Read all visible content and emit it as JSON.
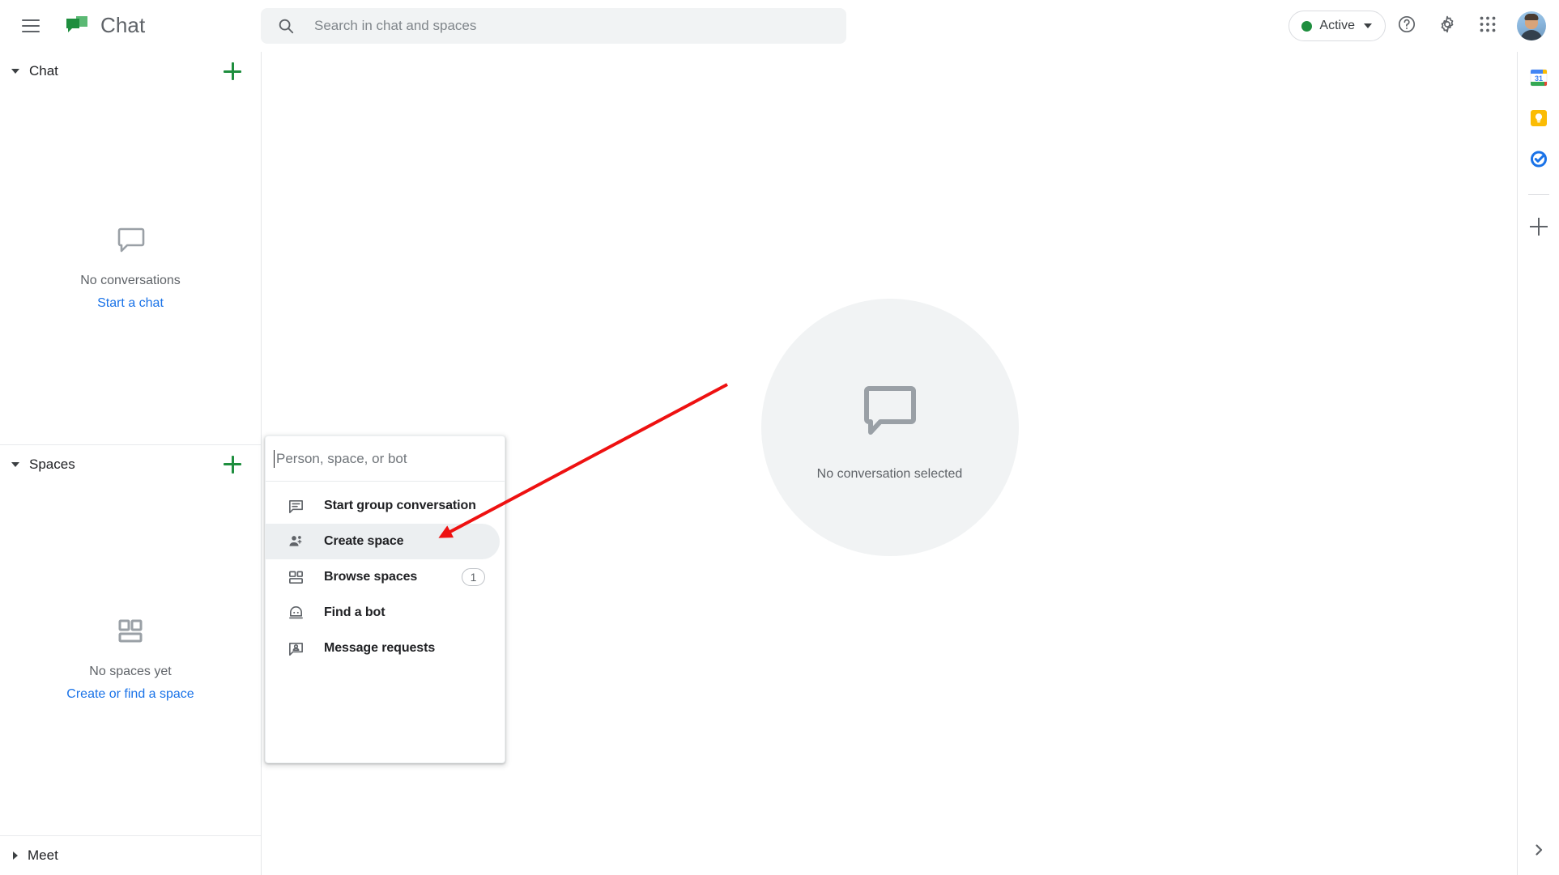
{
  "app": {
    "title": "Chat",
    "logo_icon": "google-chat-logo"
  },
  "topbar": {
    "menu_icon": "hamburger-menu-icon",
    "search": {
      "icon": "search-icon",
      "placeholder": "Search in chat and spaces",
      "value": ""
    },
    "status": {
      "label": "Active",
      "dot_color": "#1e8e3e",
      "caret_icon": "chevron-down-icon"
    },
    "help_icon": "help-question-circle-icon",
    "settings_icon": "gear-icon",
    "apps_icon": "apps-grid-icon",
    "avatar_icon": "user-avatar"
  },
  "sidebar": {
    "chat": {
      "title": "Chat",
      "expanded": true,
      "collapse_icon": "triangle-down-icon",
      "add_icon": "plus-icon",
      "empty_icon": "speech-bubble-icon",
      "empty_title": "No conversations",
      "empty_link": "Start a chat"
    },
    "spaces": {
      "title": "Spaces",
      "expanded": true,
      "collapse_icon": "triangle-down-icon",
      "add_icon": "plus-icon",
      "empty_icon": "spaces-grid-icon",
      "empty_title": "No spaces yet",
      "empty_link": "Create or find a space"
    },
    "meet": {
      "title": "Meet",
      "expanded": false,
      "collapse_icon": "triangle-right-icon"
    }
  },
  "main": {
    "empty_icon": "speech-bubble-icon",
    "empty_text": "No conversation selected"
  },
  "rail": {
    "items": [
      {
        "name": "google-calendar-icon",
        "label": "Calendar",
        "day": "31"
      },
      {
        "name": "google-keep-icon",
        "label": "Keep"
      },
      {
        "name": "google-tasks-icon",
        "label": "Tasks"
      }
    ],
    "add_icon": "plus-icon",
    "expand_icon": "chevron-right-icon"
  },
  "menu": {
    "input": {
      "placeholder": "Person, space, or bot",
      "value": ""
    },
    "items": [
      {
        "label": "Start group conversation",
        "icon": "group-conversation-icon",
        "badge": "",
        "highlighted": false
      },
      {
        "label": "Create space",
        "icon": "person-add-icon",
        "badge": "",
        "highlighted": true
      },
      {
        "label": "Browse spaces",
        "icon": "browse-spaces-icon",
        "badge": "1",
        "highlighted": false
      },
      {
        "label": "Find a bot",
        "icon": "bot-icon",
        "badge": "",
        "highlighted": false
      },
      {
        "label": "Message requests",
        "icon": "message-request-icon",
        "badge": "",
        "highlighted": false
      }
    ]
  },
  "annotation": {
    "arrow_color": "#ee1111",
    "arrow_from": "898,475",
    "arrow_to": "541,665"
  }
}
